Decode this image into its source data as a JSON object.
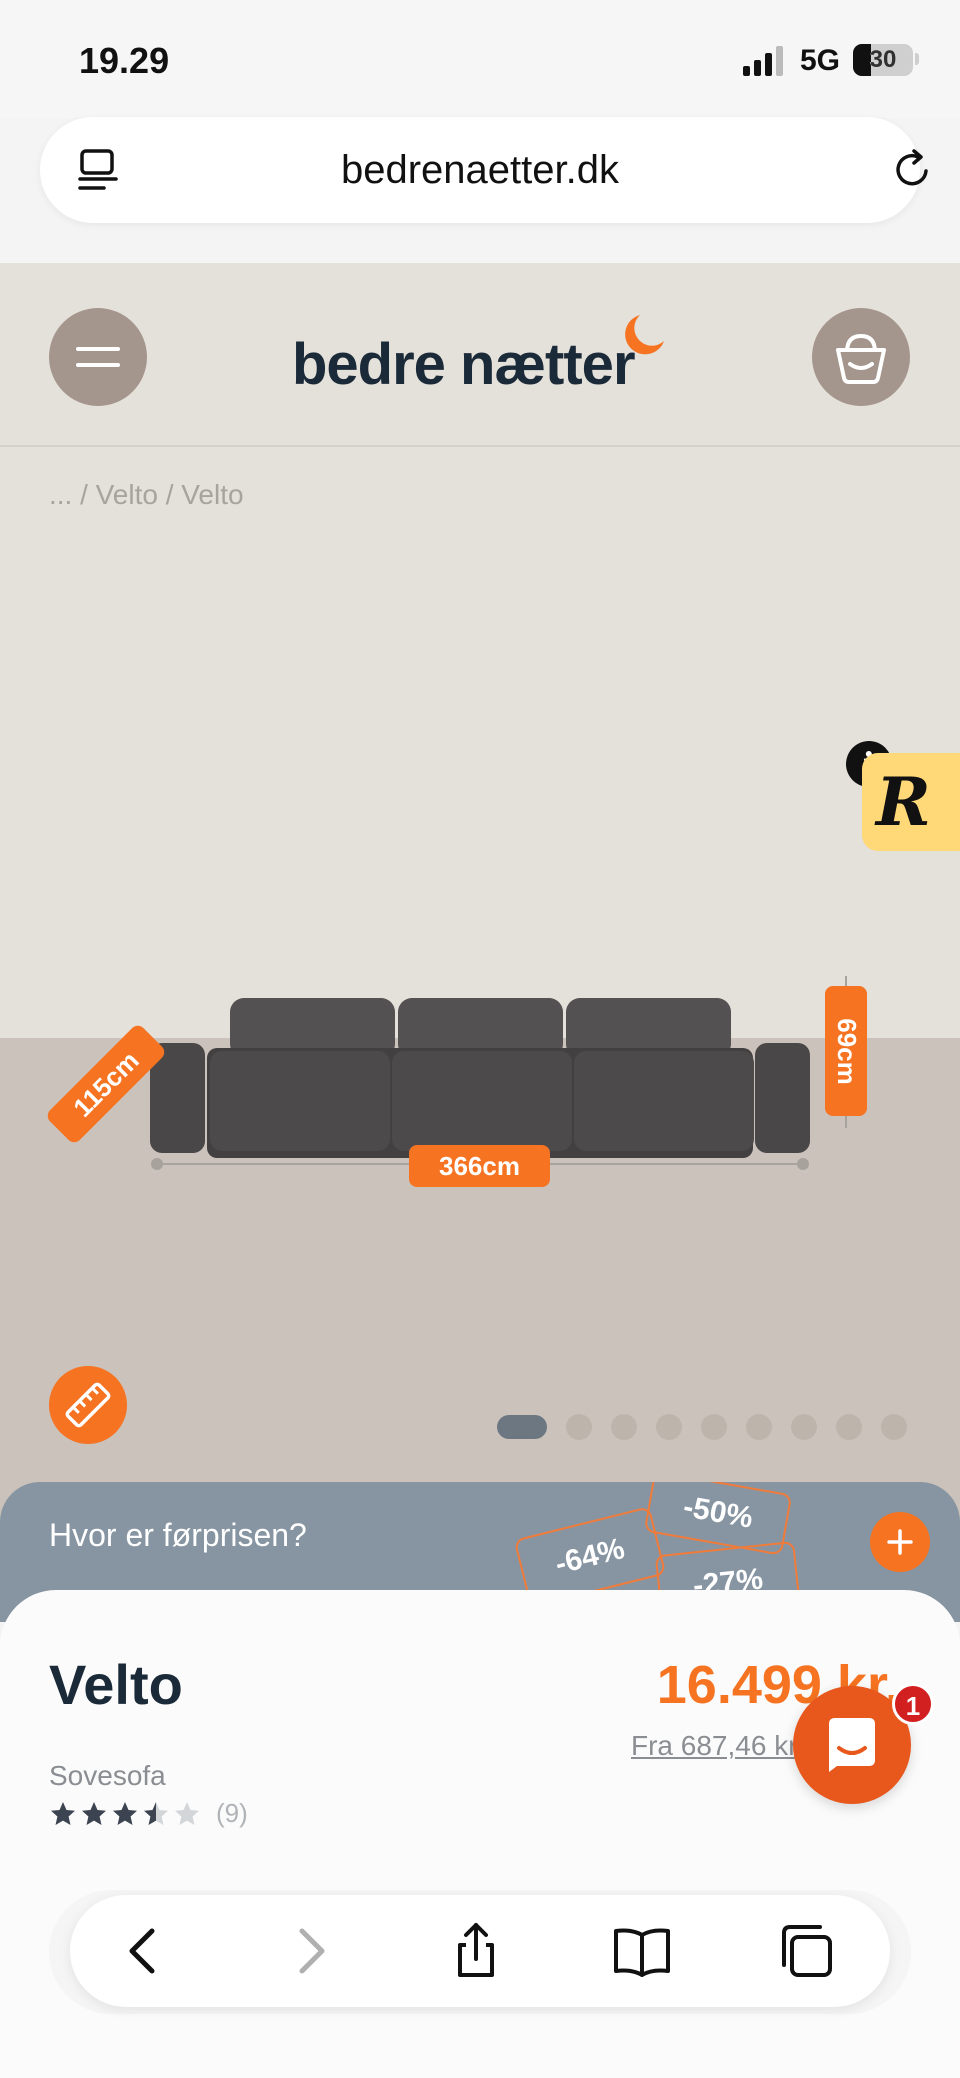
{
  "status_bar": {
    "time": "19.29",
    "network": "5G",
    "battery": "30",
    "battery_level": 0.3
  },
  "browser": {
    "url": "bedrenaetter.dk",
    "icons": [
      "reader-icon",
      "reload-icon"
    ]
  },
  "site_header": {
    "logo_text": "bedre nætter",
    "icons": [
      "menu-icon",
      "basket-icon",
      "moon-icon"
    ]
  },
  "breadcrumb": "... / Velto / Velto",
  "product_image": {
    "width_label": "366cm",
    "depth_label": "115cm",
    "height_label": "69cm",
    "gallery_count": 9,
    "active_index": 0
  },
  "reviews_widget": {
    "letter": "R",
    "info": "i"
  },
  "prior_price": {
    "question": "Hvor er førprisen?",
    "tags": [
      "-64%",
      "-50%",
      "-27%"
    ]
  },
  "product": {
    "name": "Velto",
    "type": "Sovesofa",
    "price": "16.499 kr.",
    "installment": "Fra 687,46 kr./md.",
    "rating": 3.5,
    "rating_max": 5,
    "review_count": "(9)"
  },
  "chat": {
    "badge": "1"
  },
  "colors": {
    "accent": "#f57321",
    "header_btn": "#a4968d",
    "navy": "#1b2a38",
    "banner": "#8795a2"
  }
}
